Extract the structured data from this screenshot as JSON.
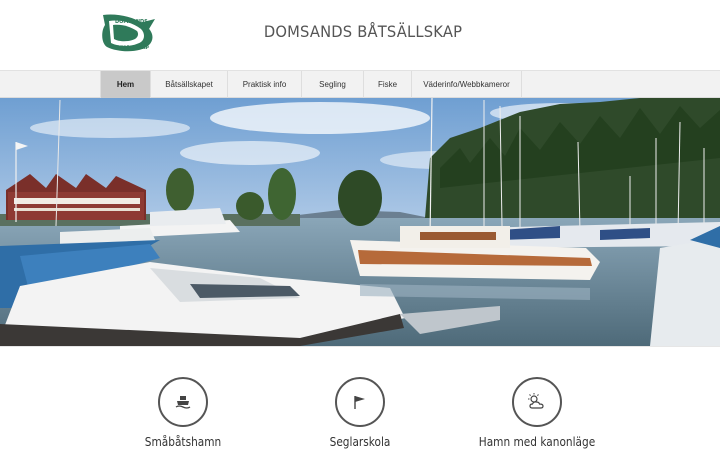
{
  "site": {
    "title": "DOMSANDS BÅTSÄLLSKAP",
    "logo_text_top": "DOMSANDS",
    "logo_text_bottom": "BÅTSÄLLSKAP"
  },
  "nav": {
    "items": [
      {
        "label": "Hem",
        "active": true
      },
      {
        "label": "Båtsällskapet",
        "active": false
      },
      {
        "label": "Praktisk info",
        "active": false
      },
      {
        "label": "Segling",
        "active": false
      },
      {
        "label": "Fiske",
        "active": false
      },
      {
        "label": "Väderinfo/Webbkameror",
        "active": false
      }
    ]
  },
  "hero": {
    "icon": "marina-photo"
  },
  "features": [
    {
      "label": "Småbåtshamn",
      "icon": "boat-icon"
    },
    {
      "label": "Seglarskola",
      "icon": "flag-icon"
    },
    {
      "label": "Hamn med kanonläge",
      "icon": "sun-cloud-icon"
    }
  ],
  "colors": {
    "brand_green": "#2f7a5a",
    "nav_active": "#c9c9c9",
    "nav_bg": "#f2f2f2"
  }
}
